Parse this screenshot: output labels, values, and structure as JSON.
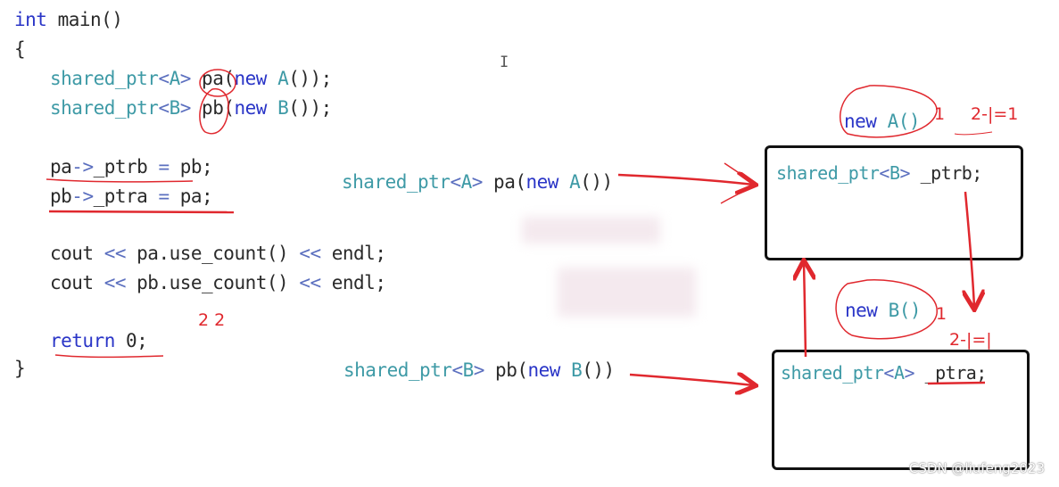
{
  "code": {
    "l1_kw": "int",
    "l1_rest": " main()",
    "l2": "{",
    "l3_ty": "shared_ptr",
    "l3_lt": "<",
    "l3_A": "A",
    "l3_gt": ">",
    "l3_var": " pa",
    "l3_op": "(",
    "l3_new": "new",
    "l3_cls": " A",
    "l3_end": "());",
    "l4_ty": "shared_ptr",
    "l4_lt": "<",
    "l4_B": "B",
    "l4_gt": ">",
    "l4_var": " pb",
    "l4_op": "(",
    "l4_new": "new",
    "l4_cls": " B",
    "l4_end": "());",
    "l5_a": "pa",
    "l5_arrow": "->",
    "l5_b": "_ptrb ",
    "l5_eq": "=",
    "l5_c": " pb;",
    "l6_a": "pb",
    "l6_arrow": "->",
    "l6_b": "_ptra ",
    "l6_eq": "=",
    "l6_c": " pa;",
    "l7_a": "cout ",
    "l7_op1": "<<",
    "l7_b": " pa.use_count() ",
    "l7_op2": "<<",
    "l7_c": " endl;",
    "l8_a": "cout ",
    "l8_op1": "<<",
    "l8_b": " pb.use_count() ",
    "l8_op2": "<<",
    "l8_c": " endl;",
    "l9_kw": "return",
    "l9_rest": " 0;",
    "l10": "}"
  },
  "diagram": {
    "stmt_a_ty": "shared_ptr",
    "stmt_a_lt": "<",
    "stmt_a_A": "A",
    "stmt_a_gt": ">",
    "stmt_a_var": " pa",
    "stmt_a_op": "(",
    "stmt_a_new": "new",
    "stmt_a_cls": " A",
    "stmt_a_end": "())",
    "stmt_b_ty": "shared_ptr",
    "stmt_b_lt": "<",
    "stmt_b_B": "B",
    "stmt_b_gt": ">",
    "stmt_b_var": " pb",
    "stmt_b_op": "(",
    "stmt_b_new": "new",
    "stmt_b_cls": " B",
    "stmt_b_end": "())",
    "box_a_ty": "shared_ptr",
    "box_a_lt": "<",
    "box_a_B": "B",
    "box_a_gt": ">",
    "box_a_field": " _ptrb;",
    "box_b_ty": "shared_ptr",
    "box_b_lt": "<",
    "box_b_A": "A",
    "box_b_gt": ">",
    "box_b_field": " _ptra;",
    "new_a_kw": "new",
    "new_a_cls": " A()",
    "new_b_kw": "new",
    "new_b_cls": " B()"
  },
  "annotations": {
    "counts": "2 2",
    "one_a": "1",
    "two_a": "2-|=1",
    "one_b": "1",
    "two_b": "2-|=|"
  },
  "cursor": "I",
  "watermark": "CSDN @liufeng2023",
  "colors": {
    "keyword": "#2a35c7",
    "type": "#3e9aa6",
    "ink": "#e0282e",
    "box": "#111111"
  }
}
